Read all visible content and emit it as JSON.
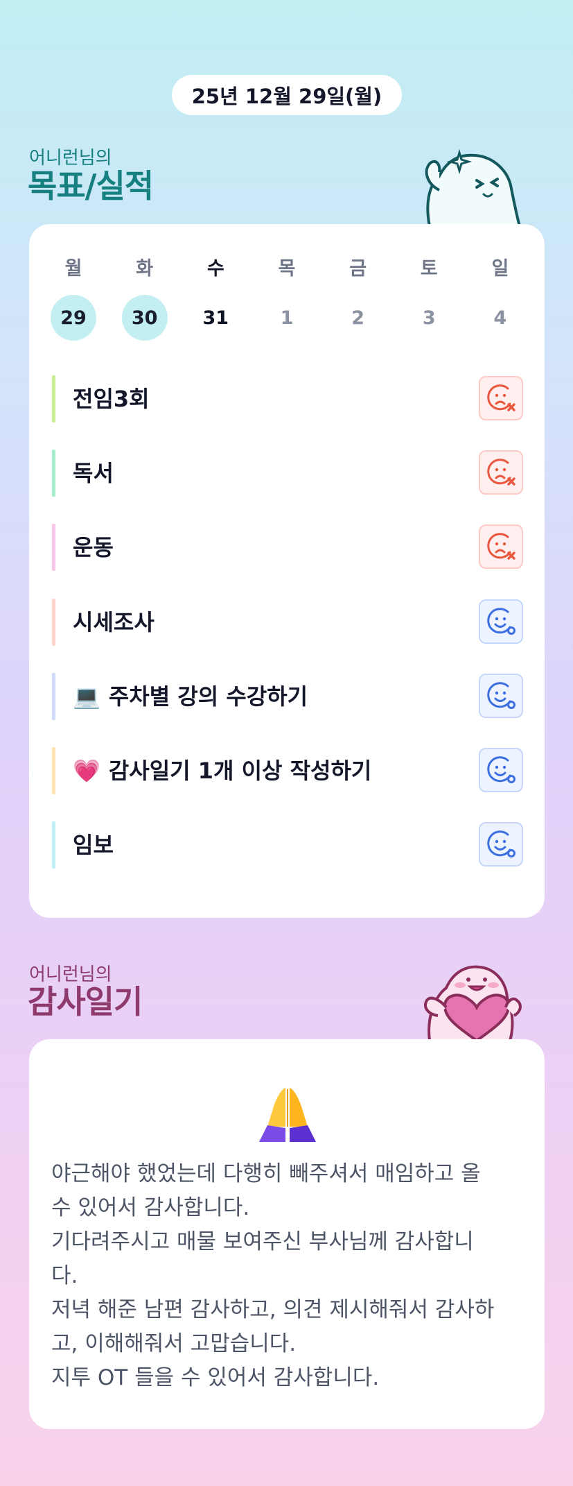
{
  "header": {
    "date": "25년 12월 29일(월)"
  },
  "goals_section": {
    "subtitle": "어니런님의",
    "title": "목표/실적",
    "week": [
      {
        "label": "월",
        "date": "29",
        "state": "done"
      },
      {
        "label": "화",
        "date": "30",
        "state": "done"
      },
      {
        "label": "수",
        "date": "31",
        "state": "today"
      },
      {
        "label": "목",
        "date": "1",
        "state": "upcoming"
      },
      {
        "label": "금",
        "date": "2",
        "state": "upcoming"
      },
      {
        "label": "토",
        "date": "3",
        "state": "upcoming"
      },
      {
        "label": "일",
        "date": "4",
        "state": "upcoming"
      }
    ],
    "goals": [
      {
        "text": "전임3회",
        "emoji": "",
        "bar_color": "#c7ec8f",
        "status": "fail",
        "status_icon": "sad-face-x-icon"
      },
      {
        "text": "독서",
        "emoji": "",
        "bar_color": "#a4ecc9",
        "status": "fail",
        "status_icon": "sad-face-x-icon"
      },
      {
        "text": "운동",
        "emoji": "",
        "bar_color": "#f7c4e7",
        "status": "fail",
        "status_icon": "sad-face-x-icon"
      },
      {
        "text": "시세조사",
        "emoji": "",
        "bar_color": "#ffd3cb",
        "status": "pending",
        "status_icon": "smile-face-o-icon"
      },
      {
        "text": "주차별 강의 수강하기",
        "emoji": "💻",
        "bar_color": "#cdd9f6",
        "status": "pending",
        "status_icon": "smile-face-o-icon"
      },
      {
        "text": "감사일기 1개 이상 작성하기",
        "emoji": "💗",
        "bar_color": "#ffe3b3",
        "status": "pending",
        "status_icon": "smile-face-o-icon"
      },
      {
        "text": "임보",
        "emoji": "",
        "bar_color": "#bdeef5",
        "status": "pending",
        "status_icon": "smile-face-o-icon"
      }
    ]
  },
  "gratitude_section": {
    "subtitle": "어니런님의",
    "title": "감사일기",
    "emoji_icon": "praying-hands-icon",
    "lines": [
      "야근해야 했었는데 다행히 빼주셔서 매임하고 올",
      "수 있어서 감사합니다.",
      "기다려주시고 매물 보여주신 부사님께 감사합니",
      "다.",
      "저녁 해준 남편 감사하고, 의견 제시해줘서 감사하",
      "고, 이해해줘서 고맙습니다.",
      "지투 OT 들을 수 있어서 감사합니다."
    ]
  },
  "colors": {
    "teal_title": "#15807f",
    "plum_title": "#8e3a6c",
    "fail_icon": "#e9573f",
    "pending_icon": "#3b6fe0",
    "completed_day": "#c3eff3"
  }
}
